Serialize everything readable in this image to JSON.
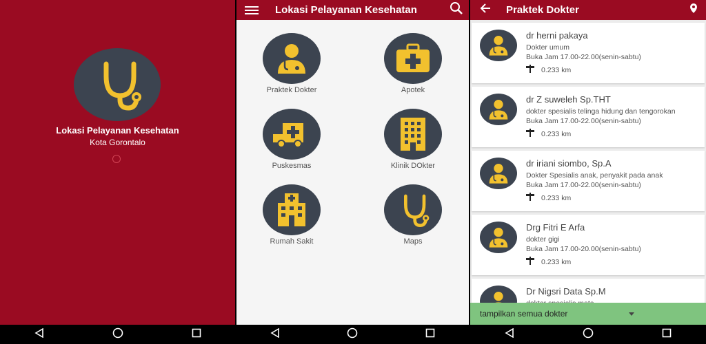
{
  "splash": {
    "title": "Lokasi Pelayanan Kesehatan",
    "subtitle": "Kota Gorontalo",
    "logo_icon": "stethoscope-icon"
  },
  "home": {
    "title": "Lokasi Pelayanan Kesehatan",
    "menu_icon": "menu-icon",
    "search_icon": "search-icon",
    "tiles": [
      {
        "label": "Praktek Dokter",
        "icon": "doctor-icon"
      },
      {
        "label": "Apotek",
        "icon": "first-aid-kit-icon"
      },
      {
        "label": "Puskesmas",
        "icon": "ambulance-icon"
      },
      {
        "label": "Klinik DOkter",
        "icon": "building-icon"
      },
      {
        "label": "Rumah Sakit",
        "icon": "hospital-icon"
      },
      {
        "label": "Maps",
        "icon": "stethoscope-icon"
      }
    ]
  },
  "list_screen": {
    "title": "Praktek Dokter",
    "doctors": [
      {
        "name": "dr herni pakaya",
        "specialty": "Dokter umum",
        "hours": "Buka Jam  17.00-22.00(senin-sabtu)",
        "distance": "0.233 km"
      },
      {
        "name": "dr Z suweleh Sp.THT",
        "specialty": "dokter spesialis telinga hidung dan tengorokan",
        "hours": "Buka Jam  17.00-22.00(senin-sabtu)",
        "distance": "0.233 km"
      },
      {
        "name": "dr iriani siombo, Sp.A",
        "specialty": "Dokter Spesialis anak, penyakit pada anak",
        "hours": "Buka Jam  17.00-22.00(senin-sabtu)",
        "distance": "0.233 km"
      },
      {
        "name": "Drg Fitri E Arfa",
        "specialty": "dokter gigi",
        "hours": "Buka Jam 17.00-20.00(senin-sabtu)",
        "distance": "0.233 km"
      },
      {
        "name": "Dr Nigsri Data Sp.M",
        "specialty": "dokter spesialis mata",
        "hours": "",
        "distance": ""
      }
    ],
    "bottom_bar": "tampilkan semua dokter"
  },
  "colors": {
    "primary": "#9a0b22",
    "icon_bg": "#3c4450",
    "icon_fg": "#f2c12e",
    "bottom_bar": "#7fc47f"
  }
}
